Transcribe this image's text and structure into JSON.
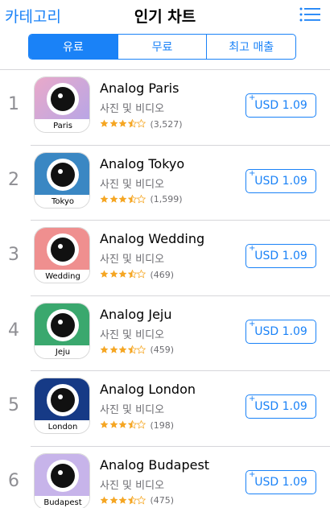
{
  "nav": {
    "back_label": "카테고리",
    "title": "인기 차트",
    "list_icon": "list-icon"
  },
  "segments": [
    {
      "label": "유료",
      "active": true
    },
    {
      "label": "무료",
      "active": false
    },
    {
      "label": "최고 매출",
      "active": false
    }
  ],
  "apps": [
    {
      "rank": "1",
      "name": "Analog Paris",
      "category": "사진 및 비디오",
      "rating": 3.5,
      "count": "(3,527)",
      "price": "USD 1.09",
      "icon_label": "Paris",
      "icon_color": "#e9a9c9",
      "icon_color2": "#b8a6e6"
    },
    {
      "rank": "2",
      "name": "Analog Tokyo",
      "category": "사진 및 비디오",
      "rating": 3.5,
      "count": "(1,599)",
      "price": "USD 1.09",
      "icon_label": "Tokyo",
      "icon_color": "#3a87c3",
      "icon_color2": "#3a87c3"
    },
    {
      "rank": "3",
      "name": "Analog Wedding",
      "category": "사진 및 비디오",
      "rating": 3.5,
      "count": "(469)",
      "price": "USD 1.09",
      "icon_label": "Wedding",
      "icon_color": "#ef8f8f",
      "icon_color2": "#ef8f8f"
    },
    {
      "rank": "4",
      "name": "Analog Jeju",
      "category": "사진 및 비디오",
      "rating": 3.5,
      "count": "(459)",
      "price": "USD 1.09",
      "icon_label": "Jeju",
      "icon_color": "#3aa86e",
      "icon_color2": "#3aa86e"
    },
    {
      "rank": "5",
      "name": "Analog London",
      "category": "사진 및 비디오",
      "rating": 3.5,
      "count": "(198)",
      "price": "USD 1.09",
      "icon_label": "London",
      "icon_color": "#163a86",
      "icon_color2": "#163a86"
    },
    {
      "rank": "6",
      "name": "Analog Budapest",
      "category": "사진 및 비디오",
      "rating": 3.5,
      "count": "(475)",
      "price": "USD 1.09",
      "icon_label": "Budapest",
      "icon_color": "#c7b4ea",
      "icon_color2": "#c7b4ea"
    }
  ],
  "colors": {
    "accent": "#1a82f7",
    "star": "#f5a623"
  }
}
